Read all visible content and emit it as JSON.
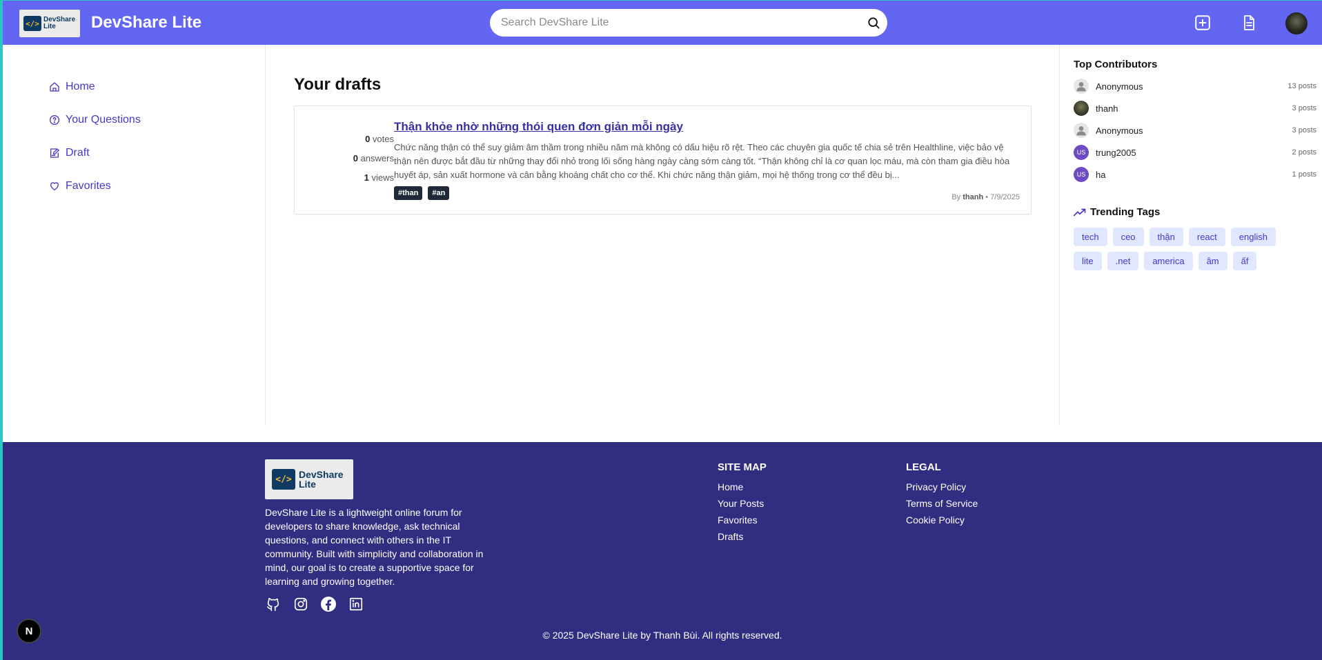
{
  "header": {
    "logo_text_line1": "DevShare",
    "logo_text_line2": "Lite",
    "logo_mark": "</>",
    "app_title": "DevShare Lite",
    "search_placeholder": "Search DevShare Lite",
    "icons": [
      "plus-square-icon",
      "document-icon",
      "avatar"
    ]
  },
  "sidebar": {
    "items": [
      {
        "label": "Home",
        "icon": "home-icon"
      },
      {
        "label": "Your Questions",
        "icon": "question-circle-icon"
      },
      {
        "label": "Draft",
        "icon": "edit-icon"
      },
      {
        "label": "Favorites",
        "icon": "heart-icon"
      }
    ]
  },
  "main": {
    "title": "Your drafts",
    "posts": [
      {
        "votes": "0",
        "votes_label": "votes",
        "answers": "0",
        "answers_label": "answers",
        "views": "1",
        "views_label": "views",
        "title": "Thận khỏe nhờ những thói quen đơn giản mỗi ngày",
        "excerpt": "Chức năng thận có thể suy giảm âm thầm trong nhiều năm mà không có dấu hiệu rõ rệt. Theo các chuyên gia quốc tế chia sẻ trên Healthline, việc bảo vệ thận nên được bắt đầu từ những thay đổi nhỏ trong lối sống hàng ngày càng sớm càng tốt. “Thận không chỉ là cơ quan lọc máu, mà còn tham gia điều hòa huyết áp, sản xuất hormone và cân bằng khoáng chất cho cơ thể. Khi chức năng thận giảm, mọi hệ thống trong cơ thể đều bị...",
        "tags": [
          "#than",
          "#an"
        ],
        "by_prefix": "By",
        "author": "thanh",
        "date": "• 7/9/2025"
      }
    ]
  },
  "right_sidebar": {
    "contributors_title": "Top Contributors",
    "contributors": [
      {
        "name": "Anonymous",
        "posts": "13 posts",
        "avatar": "anon",
        "initials": ""
      },
      {
        "name": "thanh",
        "posts": "3 posts",
        "avatar": "photo",
        "initials": ""
      },
      {
        "name": "Anonymous",
        "posts": "3 posts",
        "avatar": "anon",
        "initials": ""
      },
      {
        "name": "trung2005",
        "posts": "2 posts",
        "avatar": "us",
        "initials": "US"
      },
      {
        "name": "ha",
        "posts": "1 posts",
        "avatar": "us",
        "initials": "US"
      }
    ],
    "trending_title": "Trending Tags",
    "trending_tags": [
      "tech",
      "ceo",
      "thận",
      "react",
      "english",
      "lite",
      ".net",
      "america",
      "âm",
      "ấf"
    ]
  },
  "footer": {
    "description": "DevShare Lite is a lightweight online forum for developers to share knowledge, ask technical questions, and connect with others in the IT community. Built with simplicity and collaboration in mind, our goal is to create a supportive space for learning and growing together.",
    "social_icons": [
      "github-icon",
      "instagram-icon",
      "facebook-icon",
      "linkedin-icon"
    ],
    "sitemap_title": "SITE MAP",
    "sitemap_links": [
      "Home",
      "Your Posts",
      "Favorites",
      "Drafts"
    ],
    "legal_title": "LEGAL",
    "legal_links": [
      "Privacy Policy",
      "Terms of Service",
      "Cookie Policy"
    ],
    "copyright": "© 2025 DevShare Lite by Thanh Bùi. All rights reserved.",
    "badge": "N"
  },
  "colors": {
    "header_bg": "#6366f1",
    "footer_bg": "#312e81",
    "link": "#4338ca",
    "tag_light_bg": "#e0e7ff",
    "tag_dark_bg": "#1f2937"
  }
}
